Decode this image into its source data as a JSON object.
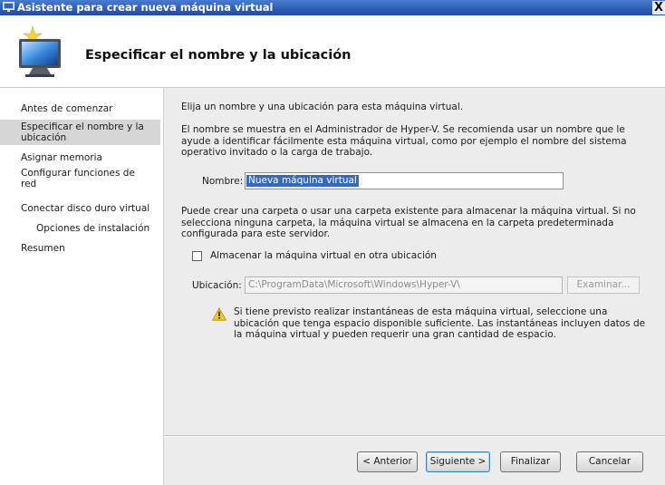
{
  "window": {
    "title": "Asistente para crear nueva máquina virtual",
    "close_glyph": "X"
  },
  "header": {
    "title": "Especificar el nombre y la ubicación",
    "icon": "computer-monitor-wizard-icon"
  },
  "nav": {
    "items": [
      {
        "label": "Antes de comenzar"
      },
      {
        "label": "Especificar el nombre y la ubicación",
        "selected": true
      },
      {
        "label": "Asignar memoria"
      },
      {
        "label": "Configurar funciones de red"
      },
      {
        "label": "Conectar disco duro virtual"
      },
      {
        "label": "Opciones de instalación"
      },
      {
        "label": "Resumen"
      }
    ]
  },
  "main": {
    "intro": "Elija un nombre y una ubicación para esta máquina virtual.",
    "name_help": "El nombre se muestra en el Administrador de Hyper-V. Se recomienda usar un nombre que le ayude a identificar fácilmente esta máquina virtual, como por ejemplo el nombre del sistema operativo invitado o la carga de trabajo.",
    "name_label": "Nombre:",
    "name_value": "Nueva máquina virtual",
    "folder_help": "Puede crear una carpeta o usar una carpeta existente para almacenar la máquina virtual. Si no selecciona ninguna carpeta, la máquina virtual se almacena en la carpeta predeterminada configurada para este servidor.",
    "store_checkbox_label": "Almacenar la máquina virtual en otra ubicación",
    "store_checked": false,
    "location_label": "Ubicación:",
    "location_value": "C:\\ProgramData\\Microsoft\\Windows\\Hyper-V\\",
    "browse_label": "Examinar...",
    "warning_text": "Si tiene previsto realizar instantáneas de esta máquina virtual, seleccione una ubicación que tenga espacio disponible suficiente. Las instantáneas incluyen datos de la máquina virtual y pueden requerir una gran cantidad de espacio.",
    "warning_icon": "warning-icon"
  },
  "buttons": {
    "previous": "< Anterior",
    "next": "Siguiente >",
    "finish": "Finalizar",
    "cancel": "Cancelar"
  },
  "colors": {
    "titlebar": "#2c5fb6",
    "selection": "#3169c6",
    "nav_selected": "#d6d6d6",
    "content_bg": "#ececec"
  }
}
